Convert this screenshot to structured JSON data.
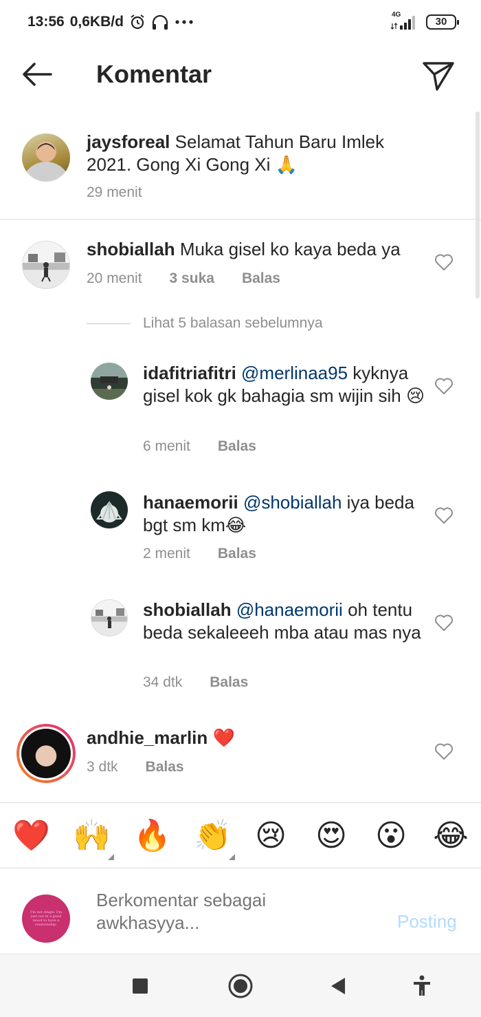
{
  "status_bar": {
    "time": "13:56",
    "data_speed": "0,6KB/d",
    "network": "4G",
    "battery": "30"
  },
  "header": {
    "title": "Komentar",
    "back_icon": "arrow-left-icon",
    "send_icon": "paper-plane-icon"
  },
  "caption": {
    "username": "jaysforeal",
    "text": "Selamat Tahun Baru Imlek 2021. Gong Xi Gong Xi 🙏",
    "time": "29 menit"
  },
  "comments": [
    {
      "username": "shobiallah",
      "text": "Muka gisel ko kaya beda ya",
      "time": "20 menit",
      "likes": "3 suka",
      "reply_label": "Balas"
    }
  ],
  "view_replies_label": "Lihat 5 balasan sebelumnya",
  "replies": [
    {
      "username": "idafitriafitri",
      "mention": "@merlinaa95",
      "text": "kyknya gisel kok gk bahagia sm wijin sih 😢",
      "time": "6 menit",
      "reply_label": "Balas"
    },
    {
      "username": "hanaemorii",
      "mention": "@shobiallah",
      "text": "iya beda bgt sm km😂",
      "time": "2 menit",
      "reply_label": "Balas"
    },
    {
      "username": "shobiallah",
      "mention": "@hanaemorii",
      "text": "oh tentu beda sekaleeeh mba atau mas nya",
      "time": "34 dtk",
      "reply_label": "Balas"
    }
  ],
  "last_comment": {
    "username": "andhie_marlin",
    "text": "❤️",
    "time": "3 dtk",
    "reply_label": "Balas"
  },
  "emoji_bar": [
    "❤️",
    "🙌",
    "🔥",
    "👏",
    "😢",
    "😍",
    "😮",
    "😂"
  ],
  "composer": {
    "placeholder": "Berkomentar sebagai awkhasyya...",
    "post_label": "Posting",
    "avatar_text": "I'm not single. I'm just not in a good mood to have a relationship."
  },
  "colors": {
    "text": "#262626",
    "secondary": "#8e8e8e",
    "mention": "#00376b",
    "post_disabled": "#b3dbff",
    "story_ring_start": "#f58529",
    "story_ring_end": "#dd2a7b"
  }
}
